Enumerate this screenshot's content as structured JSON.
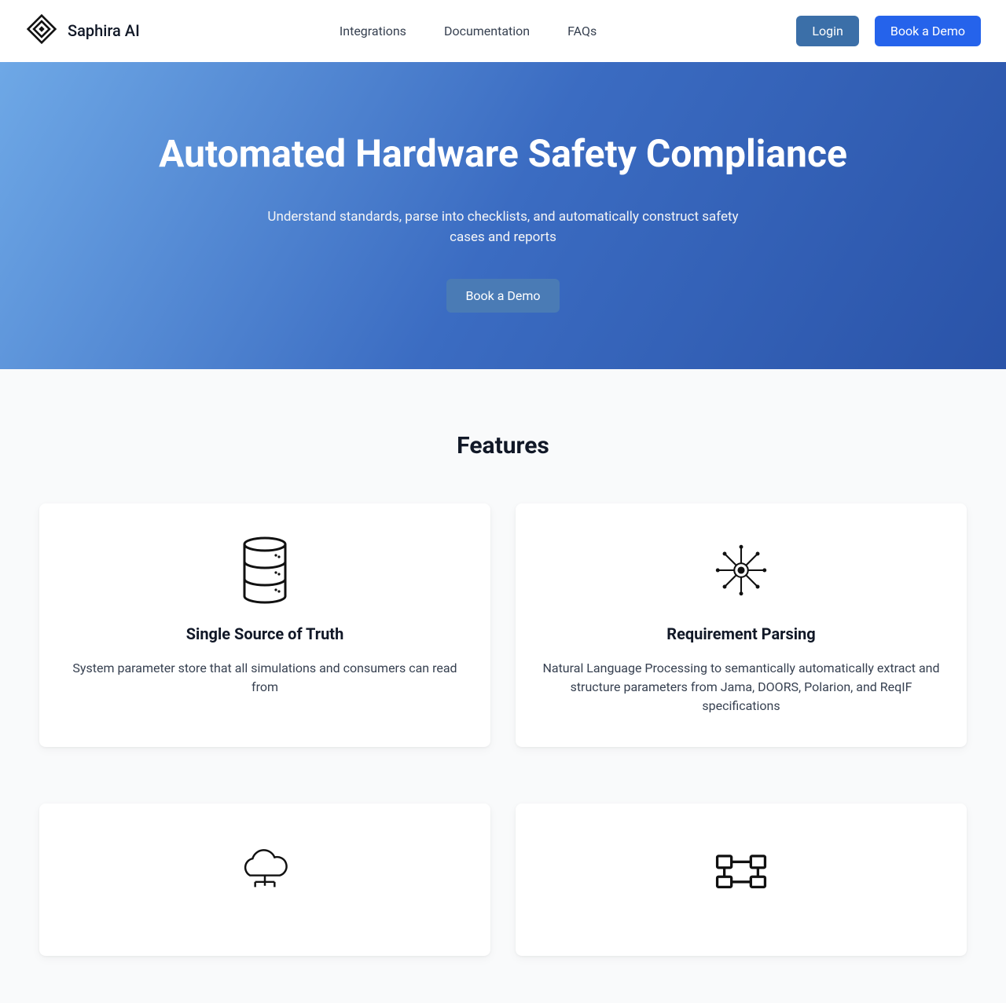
{
  "brand": {
    "name": "Saphira AI"
  },
  "nav": {
    "links": [
      {
        "label": "Integrations"
      },
      {
        "label": "Documentation"
      },
      {
        "label": "FAQs"
      }
    ],
    "login_label": "Login",
    "demo_label": "Book a Demo"
  },
  "hero": {
    "title": "Automated Hardware Safety Compliance",
    "subtitle": "Understand standards, parse into checklists, and automatically construct safety cases and reports",
    "cta_label": "Book a Demo"
  },
  "features": {
    "heading": "Features",
    "cards": [
      {
        "icon": "database-icon",
        "title": "Single Source of Truth",
        "description": "System parameter store that all simulations and consumers can read from"
      },
      {
        "icon": "circuit-icon",
        "title": "Requirement Parsing",
        "description": "Natural Language Processing to semantically automatically extract and structure parameters from Jama, DOORS, Polarion, and ReqIF specifications"
      }
    ]
  }
}
